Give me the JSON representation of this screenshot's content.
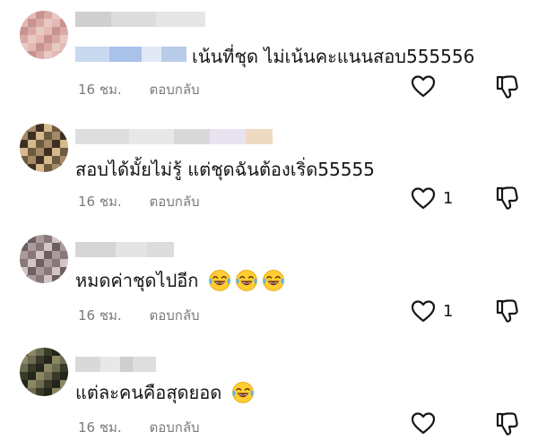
{
  "comments": [
    {
      "text": "เน้นที่ชุด ไม่เน้นคะแนนสอบ555556",
      "time": "16 ชม.",
      "reply": "ตอบกลับ",
      "likes": "",
      "emoji_count": 0,
      "avatar_colors": [
        "#e8c8c4",
        "#d9a9a4",
        "#c79390",
        "#e6b8b4"
      ]
    },
    {
      "text": "สอบได้มั้ยไม่รู้ แต่ชุดฉันต้องเริ่ด55555",
      "time": "16 ชม.",
      "reply": "ตอบกลับ",
      "likes": "1",
      "emoji_count": 0,
      "avatar_colors": [
        "#a58a68",
        "#6f5a3f",
        "#d4b98d",
        "#3d3021"
      ]
    },
    {
      "text": "หมดค่าชุดไปอีก",
      "time": "16 ชม.",
      "reply": "ตอบกลับ",
      "likes": "1",
      "emoji_count": 3,
      "avatar_colors": [
        "#a99b9c",
        "#6e5e61",
        "#d1c5c6",
        "#8a7779"
      ]
    },
    {
      "text": "แต่ละคนคือสุดยอด",
      "time": "16 ชม.",
      "reply": "ตอบกลับ",
      "likes": "",
      "emoji_count": 1,
      "avatar_colors": [
        "#3a3a2a",
        "#6b6b4f",
        "#8c8665",
        "#22251b"
      ]
    }
  ],
  "icons": {
    "like": "heart-outline-icon",
    "dislike": "thumbs-down-outline-icon",
    "emoji": "laughing-tears-emoji"
  }
}
